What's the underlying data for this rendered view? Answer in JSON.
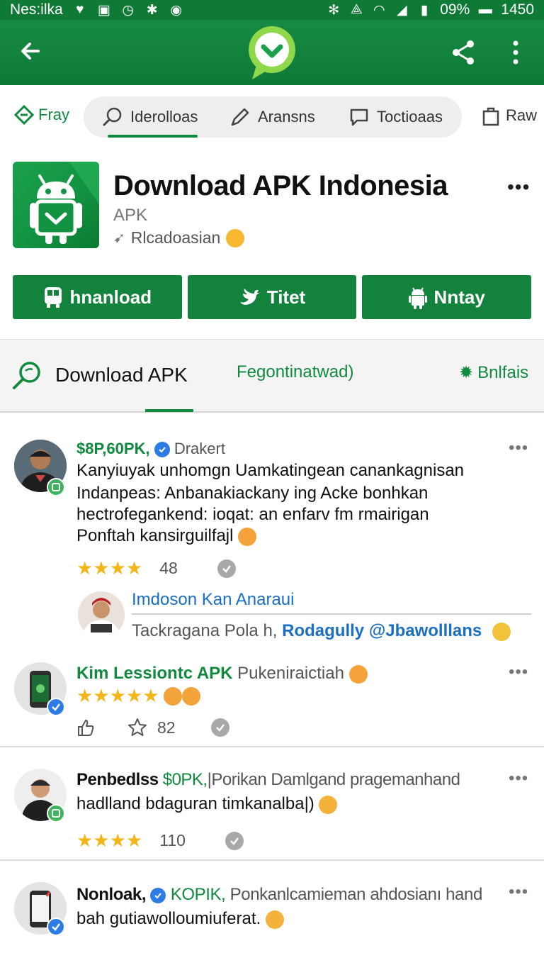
{
  "statusbar": {
    "carrier": "Nes:ilka",
    "battery": "09%",
    "time": "1450"
  },
  "filters": {
    "fray": "Fray",
    "pill": [
      "Iderolloas",
      "Aransns",
      "Toctioaas"
    ],
    "raw": "Raw"
  },
  "app": {
    "title": "Download APK Indonesia",
    "subtitle": "APK",
    "meta": "Rlcadoasian",
    "buttons": [
      "hnanload",
      "Titet",
      "Nntay"
    ]
  },
  "tabs": {
    "title": "Download APK",
    "middle": "Fegontinatwad)",
    "right": "Bnlfais"
  },
  "posts": [
    {
      "handle": "$8P,60PK,",
      "tag": "Drakert",
      "lines": [
        "Kanyiuyak unhomgn Uamkatingean canankagnisan",
        "Indanpeas: Anbanakiackany ing Acke bonhkan",
        "hectrofegankend: ioqat: an enfarv fm rmairigan",
        "Ponftah kansirguilfajl"
      ],
      "rating": "48",
      "reply": {
        "name": "Imdoson Kan Anaraui",
        "text": "Tackragana Pola h,",
        "mention": "Rodagully @Jbawolllans"
      }
    },
    {
      "title": "Kim Lessiontc APK",
      "green": "APK",
      "tag": "Pukeniraictiah",
      "rating": "82"
    },
    {
      "name": "Penbedlss",
      "green": "$0PK,",
      "tail": "|Porikan Damlgand pragemanhand",
      "line2": "hadlland bdaguran timkanalba|)",
      "rating": "110"
    },
    {
      "name": "Nonloak,",
      "green": "KOPIK,",
      "tail": "Ponkanlcamieman ahdosianı hand",
      "line2": "bah gutiawolloumiuferat."
    }
  ],
  "colors": {
    "primary": "#0f7a36",
    "accent": "#0f8a3e",
    "star": "#f2b61a",
    "mention": "#1a6fc2"
  }
}
